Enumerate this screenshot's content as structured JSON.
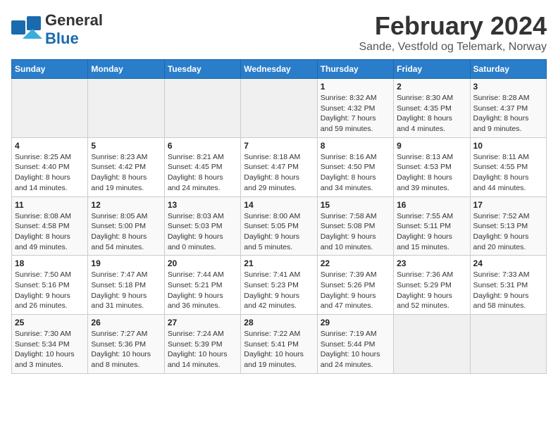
{
  "logo": {
    "part1": "General",
    "part2": "Blue"
  },
  "header": {
    "month": "February 2024",
    "location": "Sande, Vestfold og Telemark, Norway"
  },
  "weekdays": [
    "Sunday",
    "Monday",
    "Tuesday",
    "Wednesday",
    "Thursday",
    "Friday",
    "Saturday"
  ],
  "weeks": [
    [
      {
        "day": "",
        "details": ""
      },
      {
        "day": "",
        "details": ""
      },
      {
        "day": "",
        "details": ""
      },
      {
        "day": "",
        "details": ""
      },
      {
        "day": "1",
        "details": "Sunrise: 8:32 AM\nSunset: 4:32 PM\nDaylight: 7 hours\nand 59 minutes."
      },
      {
        "day": "2",
        "details": "Sunrise: 8:30 AM\nSunset: 4:35 PM\nDaylight: 8 hours\nand 4 minutes."
      },
      {
        "day": "3",
        "details": "Sunrise: 8:28 AM\nSunset: 4:37 PM\nDaylight: 8 hours\nand 9 minutes."
      }
    ],
    [
      {
        "day": "4",
        "details": "Sunrise: 8:25 AM\nSunset: 4:40 PM\nDaylight: 8 hours\nand 14 minutes."
      },
      {
        "day": "5",
        "details": "Sunrise: 8:23 AM\nSunset: 4:42 PM\nDaylight: 8 hours\nand 19 minutes."
      },
      {
        "day": "6",
        "details": "Sunrise: 8:21 AM\nSunset: 4:45 PM\nDaylight: 8 hours\nand 24 minutes."
      },
      {
        "day": "7",
        "details": "Sunrise: 8:18 AM\nSunset: 4:47 PM\nDaylight: 8 hours\nand 29 minutes."
      },
      {
        "day": "8",
        "details": "Sunrise: 8:16 AM\nSunset: 4:50 PM\nDaylight: 8 hours\nand 34 minutes."
      },
      {
        "day": "9",
        "details": "Sunrise: 8:13 AM\nSunset: 4:53 PM\nDaylight: 8 hours\nand 39 minutes."
      },
      {
        "day": "10",
        "details": "Sunrise: 8:11 AM\nSunset: 4:55 PM\nDaylight: 8 hours\nand 44 minutes."
      }
    ],
    [
      {
        "day": "11",
        "details": "Sunrise: 8:08 AM\nSunset: 4:58 PM\nDaylight: 8 hours\nand 49 minutes."
      },
      {
        "day": "12",
        "details": "Sunrise: 8:05 AM\nSunset: 5:00 PM\nDaylight: 8 hours\nand 54 minutes."
      },
      {
        "day": "13",
        "details": "Sunrise: 8:03 AM\nSunset: 5:03 PM\nDaylight: 9 hours\nand 0 minutes."
      },
      {
        "day": "14",
        "details": "Sunrise: 8:00 AM\nSunset: 5:05 PM\nDaylight: 9 hours\nand 5 minutes."
      },
      {
        "day": "15",
        "details": "Sunrise: 7:58 AM\nSunset: 5:08 PM\nDaylight: 9 hours\nand 10 minutes."
      },
      {
        "day": "16",
        "details": "Sunrise: 7:55 AM\nSunset: 5:11 PM\nDaylight: 9 hours\nand 15 minutes."
      },
      {
        "day": "17",
        "details": "Sunrise: 7:52 AM\nSunset: 5:13 PM\nDaylight: 9 hours\nand 20 minutes."
      }
    ],
    [
      {
        "day": "18",
        "details": "Sunrise: 7:50 AM\nSunset: 5:16 PM\nDaylight: 9 hours\nand 26 minutes."
      },
      {
        "day": "19",
        "details": "Sunrise: 7:47 AM\nSunset: 5:18 PM\nDaylight: 9 hours\nand 31 minutes."
      },
      {
        "day": "20",
        "details": "Sunrise: 7:44 AM\nSunset: 5:21 PM\nDaylight: 9 hours\nand 36 minutes."
      },
      {
        "day": "21",
        "details": "Sunrise: 7:41 AM\nSunset: 5:23 PM\nDaylight: 9 hours\nand 42 minutes."
      },
      {
        "day": "22",
        "details": "Sunrise: 7:39 AM\nSunset: 5:26 PM\nDaylight: 9 hours\nand 47 minutes."
      },
      {
        "day": "23",
        "details": "Sunrise: 7:36 AM\nSunset: 5:29 PM\nDaylight: 9 hours\nand 52 minutes."
      },
      {
        "day": "24",
        "details": "Sunrise: 7:33 AM\nSunset: 5:31 PM\nDaylight: 9 hours\nand 58 minutes."
      }
    ],
    [
      {
        "day": "25",
        "details": "Sunrise: 7:30 AM\nSunset: 5:34 PM\nDaylight: 10 hours\nand 3 minutes."
      },
      {
        "day": "26",
        "details": "Sunrise: 7:27 AM\nSunset: 5:36 PM\nDaylight: 10 hours\nand 8 minutes."
      },
      {
        "day": "27",
        "details": "Sunrise: 7:24 AM\nSunset: 5:39 PM\nDaylight: 10 hours\nand 14 minutes."
      },
      {
        "day": "28",
        "details": "Sunrise: 7:22 AM\nSunset: 5:41 PM\nDaylight: 10 hours\nand 19 minutes."
      },
      {
        "day": "29",
        "details": "Sunrise: 7:19 AM\nSunset: 5:44 PM\nDaylight: 10 hours\nand 24 minutes."
      },
      {
        "day": "",
        "details": ""
      },
      {
        "day": "",
        "details": ""
      }
    ]
  ]
}
